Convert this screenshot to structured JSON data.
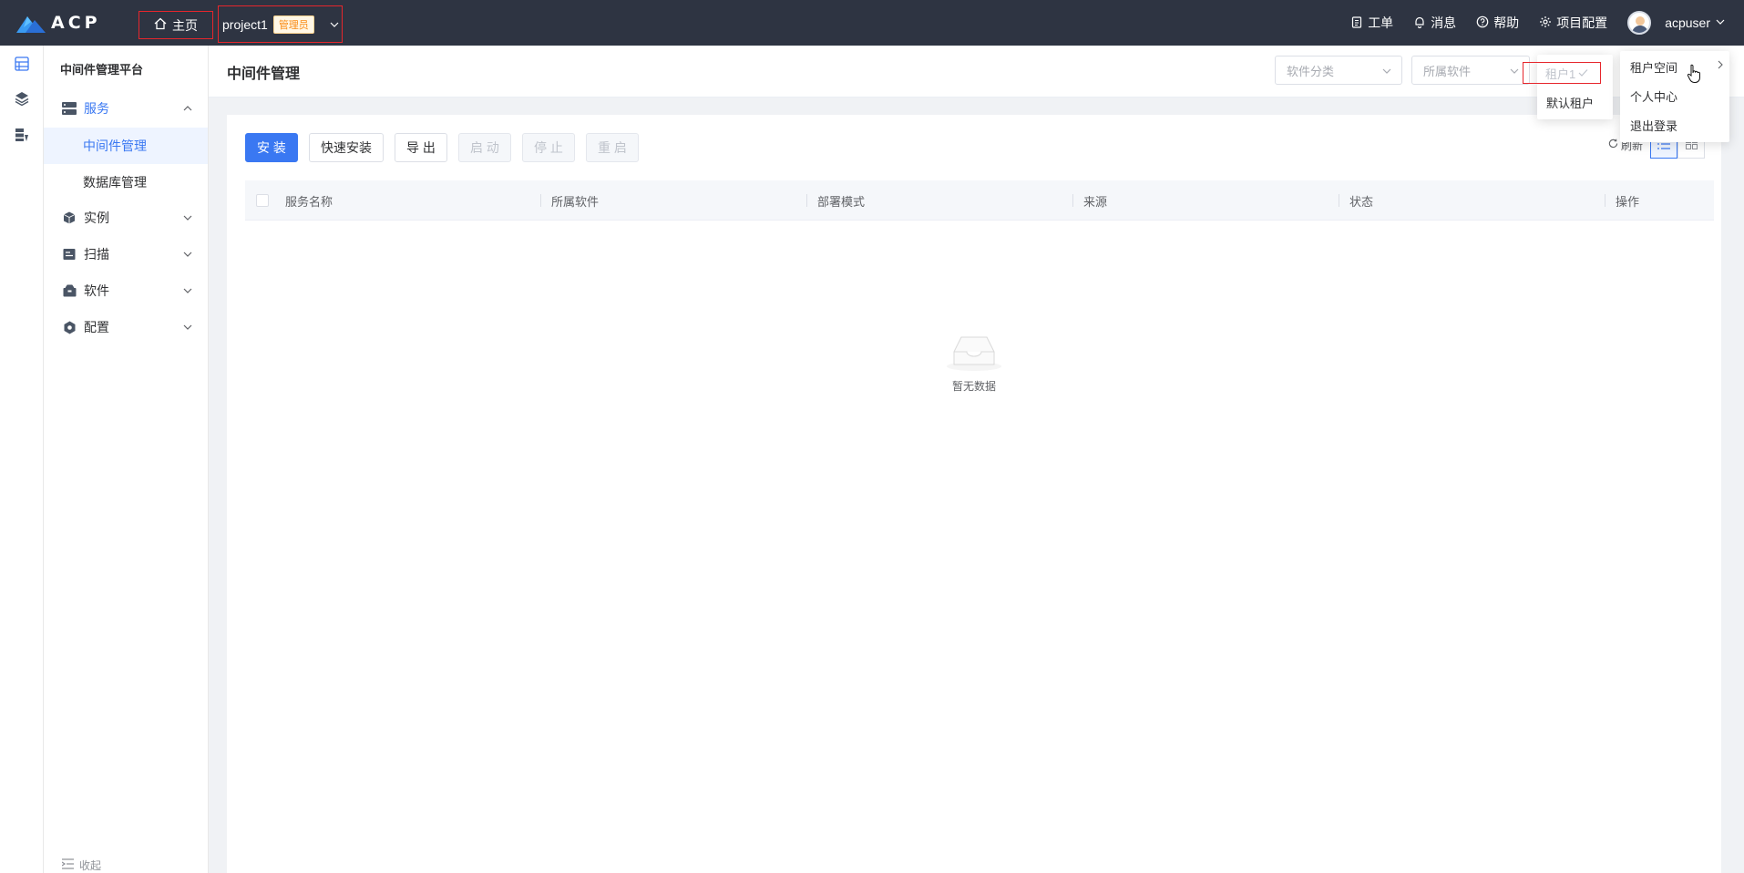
{
  "topbar": {
    "logo_text": "ACP",
    "home_label": "主页",
    "project_name": "project1",
    "project_role_badge": "管理员",
    "links": [
      {
        "label": "工单",
        "icon": "clipboard-icon"
      },
      {
        "label": "消息",
        "icon": "bell-icon"
      },
      {
        "label": "帮助",
        "icon": "help-icon"
      },
      {
        "label": "项目配置",
        "icon": "gear-icon"
      }
    ],
    "username": "acpuser"
  },
  "rail": {
    "icons": [
      "middleware-icon",
      "layers-icon",
      "database-icon"
    ]
  },
  "sidebar": {
    "title": "中间件管理平台",
    "items": [
      {
        "label": "服务",
        "icon": "server-icon",
        "expanded": true,
        "children": [
          {
            "label": "中间件管理",
            "active": true
          },
          {
            "label": "数据库管理",
            "active": false
          }
        ]
      },
      {
        "label": "实例",
        "icon": "cube-icon",
        "expanded": false
      },
      {
        "label": "扫描",
        "icon": "scan-icon",
        "expanded": false
      },
      {
        "label": "软件",
        "icon": "package-icon",
        "expanded": false
      },
      {
        "label": "配置",
        "icon": "config-icon",
        "expanded": false
      }
    ],
    "collapse_label": "收起"
  },
  "header": {
    "title": "中间件管理",
    "filters": [
      {
        "placeholder": "软件分类"
      },
      {
        "placeholder": "所属软件"
      }
    ]
  },
  "toolbar": {
    "buttons": [
      {
        "label": "安 装",
        "style": "primary"
      },
      {
        "label": "快速安装",
        "style": "default"
      },
      {
        "label": "导 出",
        "style": "default"
      },
      {
        "label": "启 动",
        "style": "disabled"
      },
      {
        "label": "停 止",
        "style": "disabled"
      },
      {
        "label": "重 启",
        "style": "disabled"
      }
    ],
    "refresh_label": "刷新"
  },
  "table": {
    "columns": [
      "服务名称",
      "所属软件",
      "部署模式",
      "来源",
      "状态",
      "操作"
    ],
    "rows": [],
    "empty_text": "暂无数据"
  },
  "user_menu": {
    "items": [
      "租户空间",
      "个人中心",
      "退出登录"
    ]
  },
  "tenant_menu": {
    "items": [
      "租户1",
      "默认租户"
    ],
    "selected": "租户1"
  },
  "colors": {
    "topbar_bg": "#2e3442",
    "primary": "#3a78f2",
    "highlight_box": "#e6262c"
  }
}
